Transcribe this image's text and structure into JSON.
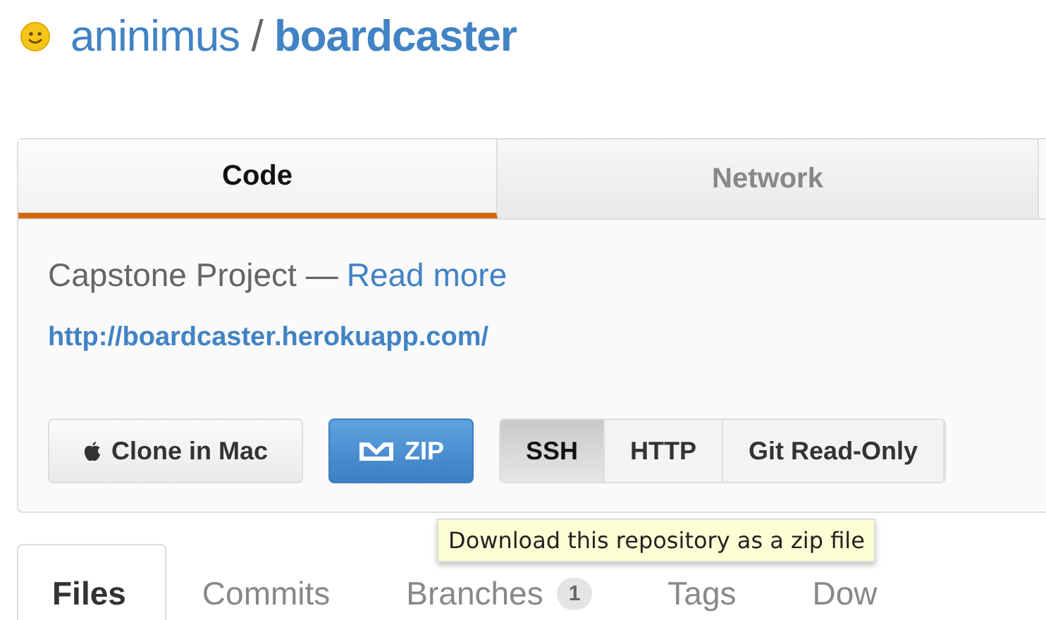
{
  "header": {
    "owner": "aninimus",
    "separator": "/",
    "repo": "boardcaster"
  },
  "tabs": [
    {
      "label": "Code",
      "selected": true
    },
    {
      "label": "Network",
      "selected": false
    }
  ],
  "description": {
    "text": "Capstone Project —",
    "link": "Read more"
  },
  "homepage": "http://boardcaster.herokuapp.com/",
  "clone_button": "Clone in Mac",
  "zip_button": "ZIP",
  "protocols": [
    {
      "label": "SSH",
      "selected": true
    },
    {
      "label": "HTTP",
      "selected": false
    },
    {
      "label": "Git Read-Only",
      "selected": false
    }
  ],
  "tooltip": "Download this repository as a zip file",
  "subtabs": [
    {
      "label": "Files",
      "selected": true
    },
    {
      "label": "Commits",
      "selected": false
    },
    {
      "label": "Branches",
      "selected": false,
      "count": "1"
    },
    {
      "label": "Tags",
      "selected": false
    },
    {
      "label": "Dow",
      "selected": false
    }
  ]
}
